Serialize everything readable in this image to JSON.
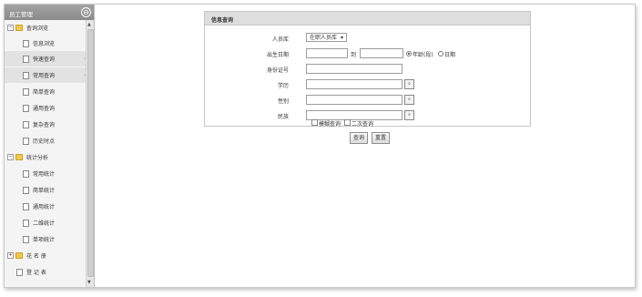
{
  "sidebar": {
    "title": "员工管理",
    "collapse_icon": "collapse-circle-icon",
    "groups": [
      {
        "label": "查询浏览",
        "items": [
          "信息浏览",
          "快速查询",
          "常用查询",
          "简单查询",
          "通用查询",
          "复杂查询",
          "历史时点"
        ]
      },
      {
        "label": "统计分析",
        "items": [
          "常用统计",
          "简单统计",
          "通用统计",
          "二维统计",
          "单项统计"
        ]
      },
      {
        "label": "花 名 册",
        "items": []
      }
    ],
    "standalone": [
      "登 记 表"
    ]
  },
  "form": {
    "panel_title": "信息查询",
    "personnel_label": "人员库",
    "personnel_value": "在职人员库",
    "birth_label": "出生日期",
    "to_label": "到",
    "age_range_label": "年龄(段)",
    "date_label": "日期",
    "id_label": "身份证号",
    "education_label": "学历",
    "gender_label": "性别",
    "ethnicity_label": "民族",
    "fuzzy_label": "模糊查询",
    "secondary_label": "二次查询",
    "query_button": "查询",
    "reset_button": "重置"
  }
}
